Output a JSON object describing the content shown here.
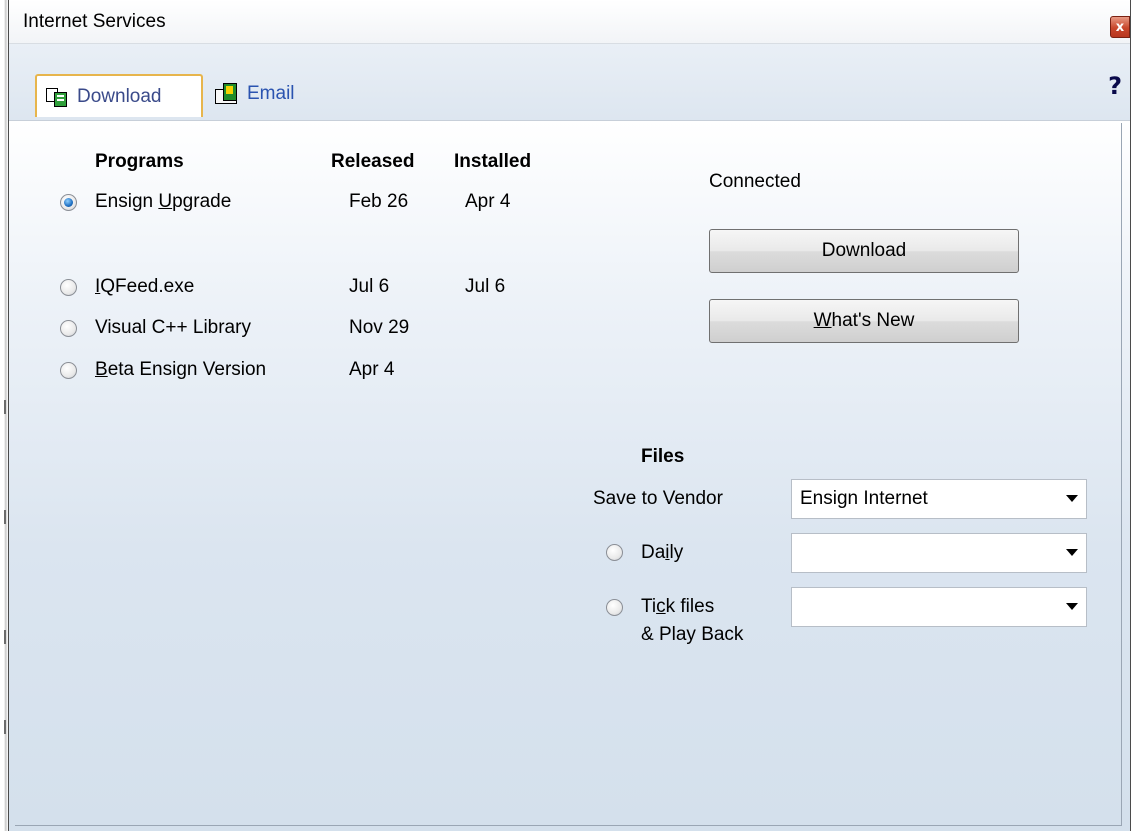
{
  "window": {
    "title": "Internet Services",
    "close_label": "x",
    "help_label": "?"
  },
  "tabs": [
    {
      "label": "Download",
      "icon": "download-tab-icon",
      "active": true
    },
    {
      "label": "Email",
      "icon": "email-tab-icon",
      "active": false
    }
  ],
  "programs": {
    "headers": {
      "programs": "Programs",
      "released": "Released",
      "installed": "Installed"
    },
    "rows": [
      {
        "pre": "Ensign ",
        "mnemonic": "U",
        "post": "pgrade",
        "released": "Feb 26",
        "installed": "Apr 4",
        "selected": true
      },
      {
        "pre": "",
        "mnemonic": "I",
        "post": "QFeed.exe",
        "released": "Jul 6",
        "installed": "Jul 6",
        "selected": false
      },
      {
        "pre": "Visual C++ Library",
        "mnemonic": "",
        "post": "",
        "released": "Nov 29",
        "installed": "",
        "selected": false
      },
      {
        "pre": "",
        "mnemonic": "B",
        "post": "eta Ensign Version",
        "released": "Apr 4",
        "installed": "",
        "selected": false
      }
    ]
  },
  "status": {
    "text": "Connected"
  },
  "buttons": {
    "download": "Download",
    "whats_new_mnemonic": "W",
    "whats_new_rest": "hat's New"
  },
  "files": {
    "header": "Files",
    "save_to_vendor_label": "Save to Vendor",
    "vendor_value": "Ensign Internet",
    "daily_pre": "Da",
    "daily_mnemonic": "i",
    "daily_post": "ly",
    "daily_value": "",
    "tick_pre": "Ti",
    "tick_mnemonic": "c",
    "tick_post": "k files",
    "tick_line2": "& Play Back",
    "tick_value": ""
  }
}
